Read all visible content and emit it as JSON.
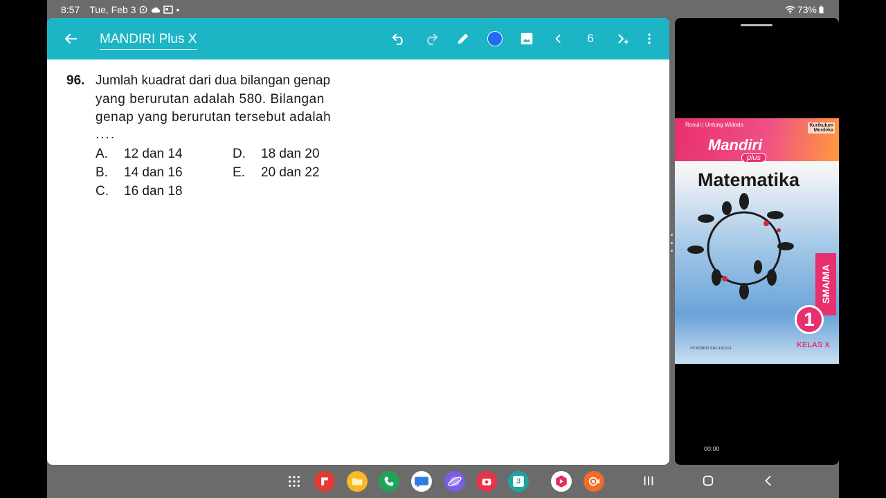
{
  "status_bar": {
    "time": "8:57",
    "date": "Tue, Feb 3",
    "icons_left": [
      "whatsapp-icon",
      "cloud-icon",
      "calendar-icon"
    ],
    "dot": "•",
    "battery": "73%",
    "icons_right": [
      "wifi-icon",
      "battery-icon"
    ]
  },
  "app": {
    "title": "MANDIRI Plus X",
    "page_number": "6",
    "accent_color": "#1bb5c6",
    "pen_color": "#1f6df2",
    "toolbar_icons": [
      "back-arrow-icon",
      "undo-icon",
      "redo-icon",
      "pen-icon",
      "color-picker",
      "image-icon",
      "previous-page-icon",
      "next-page-icon",
      "more-icon"
    ]
  },
  "question": {
    "number": "96.",
    "lines": [
      "Jumlah kuadrat dari dua bilangan genap",
      "yang berurutan adalah 580. Bilangan",
      "genap yang berurutan tersebut adalah",
      "...."
    ],
    "options": [
      {
        "letter": "A.",
        "text": "12 dan 14"
      },
      {
        "letter": "B.",
        "text": "14 dan 16"
      },
      {
        "letter": "C.",
        "text": "16 dan 18"
      },
      {
        "letter": "D.",
        "text": "18 dan 20"
      },
      {
        "letter": "E.",
        "text": "20 dan 22"
      }
    ]
  },
  "book_cover": {
    "authors": "Rosuli | Untung Widodo",
    "badge_line1": "Kurikulum",
    "badge_line2": "Merdeka",
    "brand": "Mandiri",
    "brand_sub": "plus",
    "title": "Matematika",
    "level": "SMA/MA",
    "volume": "1",
    "grade": "KELAS X",
    "publisher": "PENERBIT ERLANGGA"
  },
  "video": {
    "time": "00:00"
  },
  "taskbar": {
    "apps": [
      {
        "name": "apps-grid-icon",
        "color": "#6b6b6b"
      },
      {
        "name": "flipboard-icon",
        "color": "#e53935"
      },
      {
        "name": "files-icon",
        "color": "#f9b824"
      },
      {
        "name": "phone-icon",
        "color": "#1fa45a"
      },
      {
        "name": "messages-icon",
        "color": "#2f7de1"
      },
      {
        "name": "internet-icon",
        "color": "#7b5ce6"
      },
      {
        "name": "camera-icon",
        "color": "#e8334a"
      },
      {
        "name": "calendar-app-icon",
        "color": "#1ea4a0"
      },
      {
        "name": "video-player-icon",
        "color": "#e32b56"
      },
      {
        "name": "screen-recorder-icon",
        "color": "#f36b28"
      }
    ],
    "calendar_day": "3"
  }
}
